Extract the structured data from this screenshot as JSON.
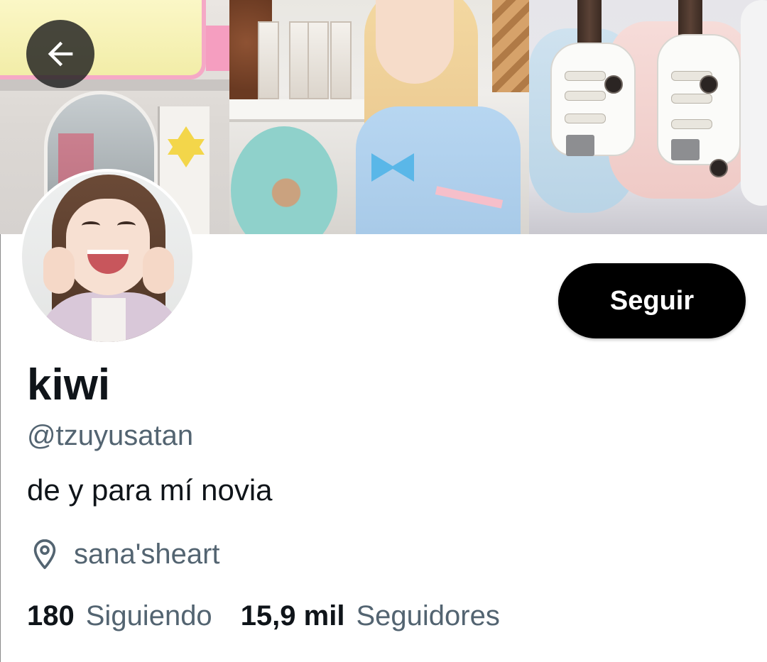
{
  "profile": {
    "display_name": "kiwi",
    "handle": "@tzuyusatan",
    "bio": "de y para mí novia",
    "location": "sana'sheart"
  },
  "actions": {
    "follow_label": "Seguir",
    "back_icon": "arrow-left-icon"
  },
  "stats": {
    "following_count": "180",
    "following_label": "Siguiendo",
    "followers_count": "15,9 mil",
    "followers_label": "Seguidores"
  },
  "colors": {
    "primary_text": "#0f1419",
    "secondary_text": "#536471",
    "follow_button_bg": "#000000",
    "follow_button_text": "#ffffff",
    "background": "#ffffff"
  },
  "icons": {
    "location": "location-pin-icon"
  }
}
